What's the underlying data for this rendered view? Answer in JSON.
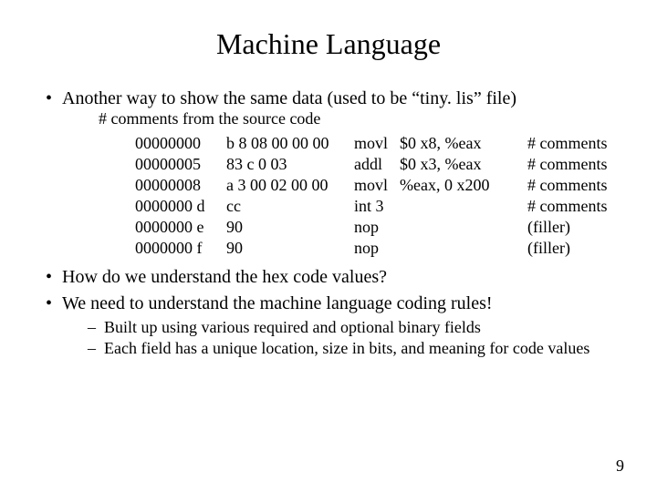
{
  "title": "Machine Language",
  "bullets": {
    "b1": "Another way to show the same data (used to be “tiny. lis” file)",
    "b2": "How do we understand the hex code values?",
    "b3": "We need to understand the machine language coding rules!"
  },
  "code": {
    "header": "# comments from the source code",
    "rows": [
      {
        "addr": "00000000",
        "hex": "b 8 08 00 00 00",
        "inst": "movl",
        "ops": "$0 x8, %eax",
        "cmt": "# comments"
      },
      {
        "addr": "00000005",
        "hex": "83 c 0 03",
        "inst": "addl",
        "ops": "$0 x3, %eax",
        "cmt": "# comments"
      },
      {
        "addr": "00000008",
        "hex": "a 3 00 02 00 00",
        "inst": "movl",
        "ops": "%eax, 0 x200",
        "cmt": "# comments"
      },
      {
        "addr": "0000000 d",
        "hex": "cc",
        "inst": "int 3",
        "ops": "",
        "cmt": "# comments"
      },
      {
        "addr": "0000000 e",
        "hex": "90",
        "inst": "nop",
        "ops": "",
        "cmt": "(filler)"
      },
      {
        "addr": "0000000 f",
        "hex": "90",
        "inst": "nop",
        "ops": "",
        "cmt": "(filler)"
      }
    ]
  },
  "sub": {
    "s1": "Built up using various required and optional binary fields",
    "s2": "Each field has a unique location, size in bits, and meaning for code values"
  },
  "page_number": "9"
}
